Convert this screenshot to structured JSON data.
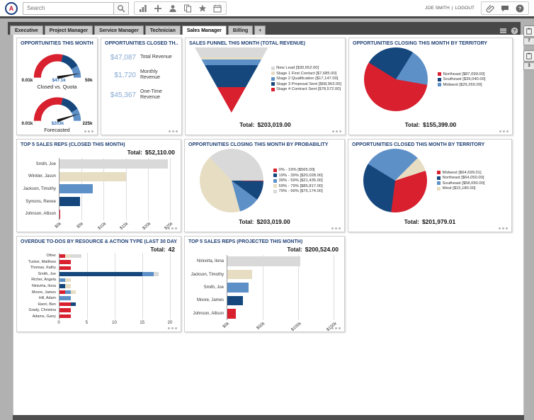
{
  "palette": {
    "red": "#d8202f",
    "navy": "#15477d",
    "lightblue": "#5e90c8",
    "beige": "#e6ddc3",
    "gray": "#d9d9d9",
    "title_blue": "#1d3e73",
    "value_blue": "#84a8d2",
    "needle": "#161616"
  },
  "ui": {
    "topbar": {
      "logo_letter": "A",
      "search_placeholder": "Search",
      "toolbar_icons": [
        "chart-icon",
        "add-icon",
        "contact-icon",
        "copy-icon",
        "star-icon",
        "calendar-icon"
      ],
      "user_name": "JOE SMITH",
      "divider": "|",
      "logout_label": "LOGOUT",
      "right_icons": [
        "link-icon",
        "chat-icon",
        "help-icon"
      ]
    },
    "tabs": {
      "items": [
        "Executive",
        "Project Manager",
        "Service Manager",
        "Technician",
        "Sales Manager",
        "Billing"
      ],
      "active": "Sales Manager",
      "add_label": "+"
    },
    "tabstrip_icons": [
      "menu-icon",
      "tab-help-icon"
    ],
    "dock": [
      {
        "icon": "clipboard-icon",
        "badge": "7"
      },
      {
        "icon": "clipboard-icon",
        "badge": "3"
      }
    ]
  },
  "widgets": {
    "opps_this_month": {
      "title": "OPPORTUNITIES THIS MONTH",
      "gauges": [
        {
          "min_label": "0.01k",
          "value_label": "$47.1k",
          "max_label": "50k",
          "caption": "Closed vs. Quota",
          "value_fraction": 0.94
        },
        {
          "min_label": "0.01k",
          "value_label": "$203k",
          "max_label": "225k",
          "caption": "Forecasted",
          "value_fraction": 0.9
        }
      ]
    },
    "opps_closed": {
      "title": "OPPORTUNITIES CLOSED TH...",
      "metrics": [
        {
          "value": "$47,087",
          "label": "Total Revenue"
        },
        {
          "value": "$1,720",
          "label": "Monthly Revenue"
        },
        {
          "value": "$45,367",
          "label": "One-Time Revenue"
        }
      ]
    },
    "sales_funnel": {
      "title": "SALES FUNNEL THIS MONTH (TOTAL REVENUE)",
      "total_label": "Total:",
      "total_value": "$203,019.00",
      "type": "funnel",
      "segments": [
        {
          "label": "New Lead [$30,652.00]",
          "value": 30652,
          "color": "gray"
        },
        {
          "label": "Stage 1 First Contact [$7,685.00]",
          "value": 7685,
          "color": "beige"
        },
        {
          "label": "Stage 2 Qualification [$17,147.00]",
          "value": 17147,
          "color": "lightblue"
        },
        {
          "label": "Stage 3 Proposal Sent [$68,963.00]",
          "value": 68963,
          "color": "navy"
        },
        {
          "label": "Stage 4 Contract Sent [$78,572.00]",
          "value": 78572,
          "color": "red"
        }
      ]
    },
    "closing_by_territory": {
      "title": "OPPORTUNITIES CLOSING THIS MONTH BY TERRITORY",
      "total_label": "Total:",
      "total_value": "$155,399.00",
      "type": "pie",
      "slices": [
        {
          "label": "Northeast [$87,099.00]",
          "value": 87099,
          "color": "red"
        },
        {
          "label": "Southeast [$39,040.00]",
          "value": 39040,
          "color": "navy"
        },
        {
          "label": "Midwest [$29,260.00]",
          "value": 29260,
          "color": "lightblue"
        }
      ]
    },
    "top5_closed": {
      "title": "TOP 5 SALES REPS (CLOSED THIS MONTH)",
      "total_label": "Total:",
      "total_value": "$52,110.00",
      "type": "bar",
      "categories": [
        "Smith, Joe",
        "Winkler, Jason",
        "Jackson, Timothy",
        "Symons, Renee",
        "Johnson, Allison"
      ],
      "values": [
        24500,
        15100,
        7600,
        4700,
        210
      ],
      "colors": [
        "gray",
        "beige",
        "lightblue",
        "navy",
        "red"
      ],
      "axis": {
        "ticks": [
          "$0k",
          "$5k",
          "$10k",
          "$15k",
          "$20k",
          "$25k"
        ],
        "max": 25000,
        "rotated": true
      }
    },
    "closing_by_probability": {
      "title": "OPPORTUNITIES CLOSING THIS MONTH BY PROBABILITY",
      "total_label": "Total:",
      "total_value": "$203,019.00",
      "type": "pie",
      "slices": [
        {
          "label": "0% - 19% [$565.00]",
          "value": 565,
          "color": "red"
        },
        {
          "label": "19% - 39% [$20,028.00]",
          "value": 20028,
          "color": "navy"
        },
        {
          "label": "39% - 59% [$21,435.00]",
          "value": 21435,
          "color": "lightblue"
        },
        {
          "label": "59% - 79% [$85,817.00]",
          "value": 85817,
          "color": "beige"
        },
        {
          "label": "79% - 99% [$75,174.00]",
          "value": 75174,
          "color": "gray"
        }
      ]
    },
    "closed_by_territory": {
      "title": "OPPORTUNITIES CLOSED THIS MONTH BY TERRITORY",
      "total_label": "Total:",
      "total_value": "$201,979.01",
      "type": "pie",
      "slices": [
        {
          "label": "Midwest [$64,699.01]",
          "value": 64699.01,
          "color": "red"
        },
        {
          "label": "Northeast [$64,050.00]",
          "value": 64050,
          "color": "navy"
        },
        {
          "label": "Southeast [$58,050.00]",
          "value": 58050,
          "color": "lightblue"
        },
        {
          "label": "West [$15,180.00]",
          "value": 15180,
          "color": "beige"
        }
      ]
    },
    "overdue_todos": {
      "title": "OVERDUE TO-DOS BY RESOURCE & ACTION TYPE (LAST 30 DAY...",
      "total_label": "Total:",
      "total_value": "42",
      "type": "stacked-bar",
      "rows": [
        {
          "label": "Other",
          "segments": [
            {
              "color": "red",
              "value": 1
            },
            {
              "color": "beige",
              "value": 1
            },
            {
              "color": "gray",
              "value": 2
            }
          ]
        },
        {
          "label": "Tucker, Matthew",
          "segments": [
            {
              "color": "red",
              "value": 2
            }
          ]
        },
        {
          "label": "Thomas, Kathy",
          "segments": [
            {
              "color": "red",
              "value": 2
            }
          ]
        },
        {
          "label": "Smith, Joe",
          "segments": [
            {
              "color": "navy",
              "value": 15
            },
            {
              "color": "lightblue",
              "value": 2
            },
            {
              "color": "gray",
              "value": 1
            }
          ]
        },
        {
          "label": "Richer, Angela",
          "segments": [
            {
              "color": "lightblue",
              "value": 1
            },
            {
              "color": "beige",
              "value": 1
            }
          ]
        },
        {
          "label": "Ninivirta, Ilona",
          "segments": [
            {
              "color": "navy",
              "value": 1
            },
            {
              "color": "beige",
              "value": 1
            }
          ]
        },
        {
          "label": "Moore, James",
          "segments": [
            {
              "color": "red",
              "value": 1
            },
            {
              "color": "lightblue",
              "value": 1
            },
            {
              "color": "beige",
              "value": 1
            }
          ]
        },
        {
          "label": "Hill, Adam",
          "segments": [
            {
              "color": "lightblue",
              "value": 2
            }
          ]
        },
        {
          "label": "Hanri, Ben",
          "segments": [
            {
              "color": "red",
              "value": 2
            },
            {
              "color": "navy",
              "value": 1
            }
          ]
        },
        {
          "label": "Grady, Christina",
          "segments": [
            {
              "color": "red",
              "value": 2
            }
          ]
        },
        {
          "label": "Adams, Garry",
          "segments": [
            {
              "color": "red",
              "value": 2
            }
          ]
        }
      ],
      "axis": {
        "ticks": [
          "0",
          "5",
          "10",
          "15",
          "20"
        ],
        "max": 20,
        "rotated": false
      }
    },
    "top5_projected": {
      "title": "TOP 5 SALES REPS (PROJECTED THIS MONTH)",
      "total_label": "Total:",
      "total_value": "$200,524.00",
      "type": "bar",
      "categories": [
        "Ninivirta, Ilona",
        "Jackson, Timothy",
        "Smith, Joe",
        "Moore, James",
        "Johnson, Allison"
      ],
      "values": [
        103000,
        34500,
        29500,
        21500,
        12024
      ],
      "colors": [
        "gray",
        "beige",
        "lightblue",
        "navy",
        "red"
      ],
      "axis": {
        "ticks": [
          "$0k",
          "$50k",
          "$100k",
          "$150k"
        ],
        "max": 150000,
        "rotated": true
      }
    }
  }
}
